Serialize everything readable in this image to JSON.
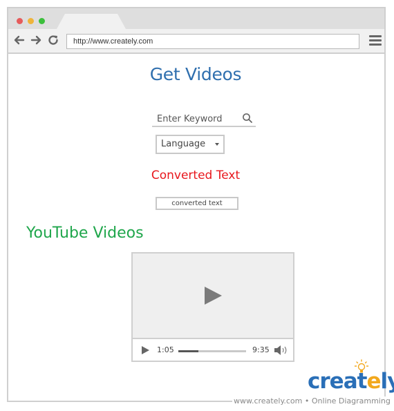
{
  "browser": {
    "url": "http://www.creately.com",
    "window_dots": [
      "#e65b5b",
      "#efb43b",
      "#3cbf3c"
    ]
  },
  "header": {
    "title": "Get Videos"
  },
  "search": {
    "placeholder": "Enter Keyword"
  },
  "language_select": {
    "selected": "Language"
  },
  "converted": {
    "heading": "Converted Text",
    "box_text": "converted text"
  },
  "videos": {
    "heading": "YouTube Videos",
    "player": {
      "current_time": "1:05",
      "total_time": "9:35",
      "progress_fraction": 0.3
    }
  },
  "branding": {
    "logo_main": "creat",
    "logo_accent": "e",
    "logo_tail": "ly",
    "footer_site": "www.creately.com",
    "footer_sep": "•",
    "footer_tag": "Online Diagramming"
  },
  "colors": {
    "title_blue": "#2f6fae",
    "converted_red": "#e8161c",
    "youtube_green": "#1fa64b",
    "brand_blue": "#2a6fb7",
    "brand_orange": "#f2a81d"
  },
  "icons": [
    "back-arrow-icon",
    "forward-arrow-icon",
    "reload-icon",
    "hamburger-menu-icon",
    "search-icon",
    "dropdown-caret-icon",
    "play-icon",
    "volume-icon",
    "lightbulb-icon"
  ]
}
